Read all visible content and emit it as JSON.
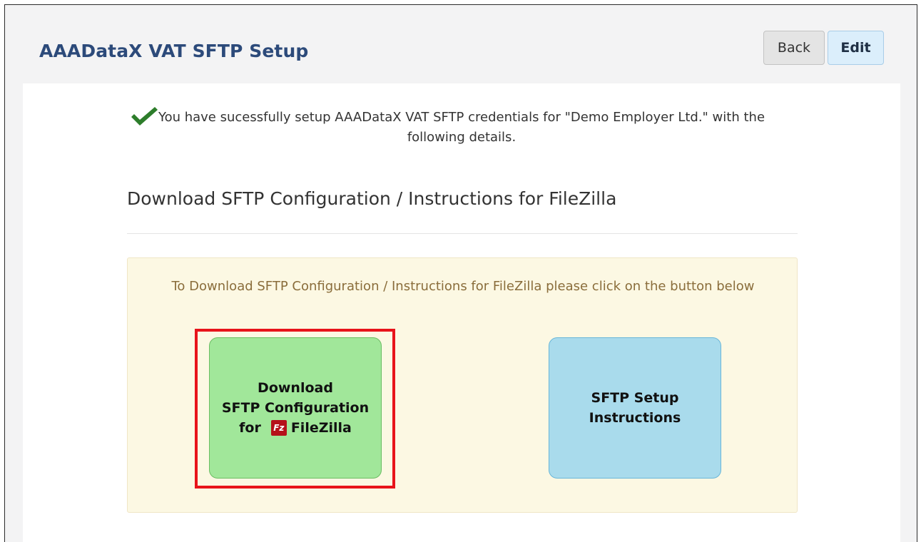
{
  "header": {
    "title": "AAADataX VAT SFTP Setup",
    "back_label": "Back",
    "edit_label": "Edit"
  },
  "success": {
    "message": "You have sucessfully setup AAADataX VAT SFTP credentials for \"Demo Employer Ltd.\" with the following details.",
    "icon": "check-icon"
  },
  "section": {
    "title": "Download SFTP Configuration / Instructions for FileZilla"
  },
  "info": {
    "text": "To Download SFTP Configuration / Instructions for FileZilla please click on the button below"
  },
  "tiles": {
    "download": {
      "line1": "Download",
      "line2": "SFTP Configuration",
      "line3_prefix": "for",
      "line3_app": "FileZilla",
      "icon": "filezilla-icon",
      "icon_text": "Fz"
    },
    "instructions": {
      "line1": "SFTP Setup",
      "line2": "Instructions"
    }
  },
  "colors": {
    "title": "#2c4a7a",
    "highlight": "#e8141b",
    "download_tile": "#a1e79a",
    "instructions_tile": "#a9dbec",
    "info_bg": "#fcf8e3",
    "check": "#2d7d2b"
  }
}
